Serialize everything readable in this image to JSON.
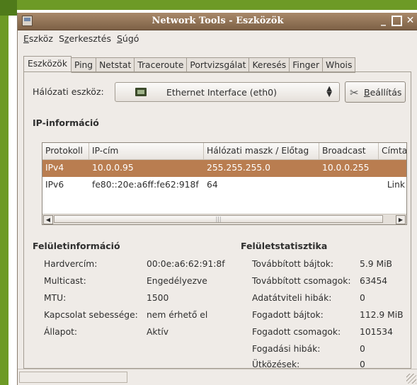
{
  "window": {
    "title": "Network Tools - Eszközök"
  },
  "menu": [
    {
      "pre": "",
      "u": "E",
      "rest": "szköz"
    },
    {
      "pre": "S",
      "u": "z",
      "rest": "erkesztés"
    },
    {
      "pre": "",
      "u": "S",
      "rest": "úgó"
    }
  ],
  "tabs": [
    "Eszközök",
    "Ping",
    "Netstat",
    "Traceroute",
    "Portvizsgálat",
    "Keresés",
    "Finger",
    "Whois"
  ],
  "device": {
    "label": "Hálózati eszköz:",
    "selected": "Ethernet Interface (eth0)",
    "settings_pre": "",
    "settings_u": "B",
    "settings_rest": "eállítás"
  },
  "ip_info": {
    "title": "IP-információ",
    "columns": [
      "Protokoll",
      "IP-cím",
      "Hálózati maszk / Előtag",
      "Broadcast",
      "Címta"
    ],
    "rows": [
      [
        "IPv4",
        "10.0.0.95",
        "255.255.255.0",
        "10.0.0.255",
        ""
      ],
      [
        "IPv6",
        "fe80::20e:a6ff:fe62:918f",
        "64",
        "",
        "Link"
      ]
    ],
    "scroll_mark": "|||"
  },
  "iface_info": {
    "title": "Felületinformáció",
    "items": [
      {
        "label": "Hardvercím:",
        "value": "00:0e:a6:62:91:8f"
      },
      {
        "label": "Multicast:",
        "value": "Engedélyezve"
      },
      {
        "label": "MTU:",
        "value": "1500"
      },
      {
        "label": "Kapcsolat sebessége:",
        "value": "nem érhető el"
      },
      {
        "label": "Állapot:",
        "value": "Aktív"
      }
    ]
  },
  "iface_stats": {
    "title": "Felületstatisztika",
    "items": [
      {
        "label": "Továbbított bájtok:",
        "value": "5.9 MiB"
      },
      {
        "label": "Továbbított csomagok:",
        "value": "63454"
      },
      {
        "label": "Adatátviteli hibák:",
        "value": "0"
      },
      {
        "label": "Fogadott bájtok:",
        "value": "112.9 MiB"
      },
      {
        "label": "Fogadott csomagok:",
        "value": "101534"
      },
      {
        "label": "Fogadási hibák:",
        "value": "0"
      },
      {
        "label": "Ütközések:",
        "value": "0"
      }
    ]
  },
  "colors": {
    "titlebar": "#8f7256",
    "selection": "#b97d50",
    "desktop": "#6d9a26"
  }
}
